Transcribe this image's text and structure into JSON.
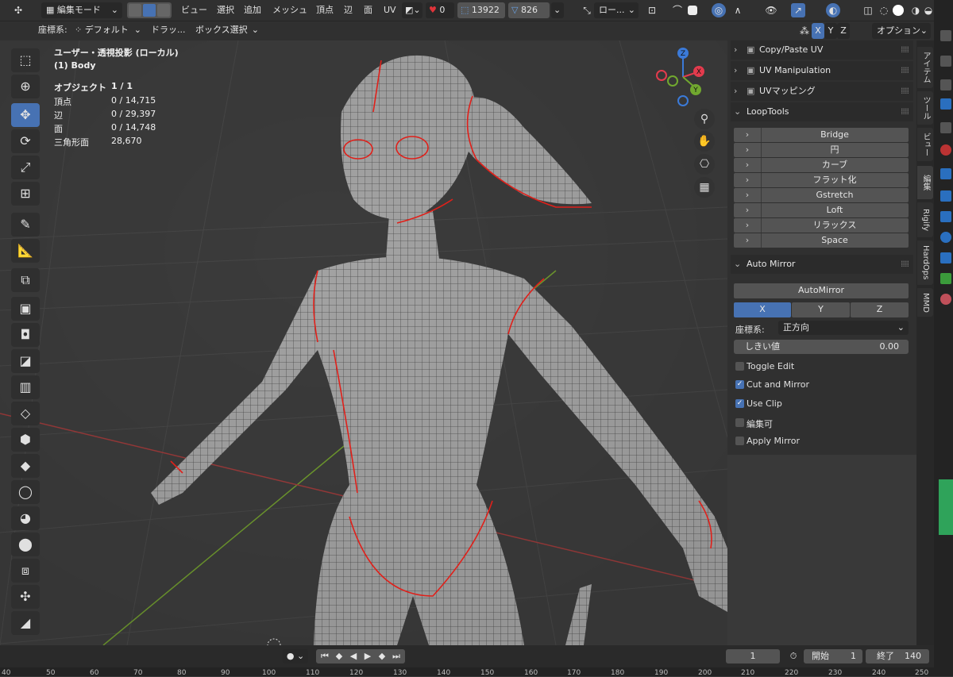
{
  "header": {
    "mode": "編集モード",
    "menus": [
      "ビュー",
      "選択",
      "追加",
      "メッシュ",
      "頂点",
      "辺",
      "面",
      "UV"
    ],
    "stats": {
      "warnings": "0",
      "vertices": "13922",
      "faces": "826"
    },
    "pivot": "ロー...",
    "coord_label": "座標系:",
    "coord_value": "デフォルト",
    "drag_label": "ドラッ...",
    "drag_value": "ボックス選択",
    "axis_x": "X",
    "axis_y": "Y",
    "axis_z": "Z",
    "options": "オプション"
  },
  "viewport": {
    "view_title": "ユーザー・透視投影 (ローカル)",
    "object_name": "(1) Body",
    "stats": [
      {
        "label": "オブジェクト",
        "value": "1 / 1"
      },
      {
        "label": "頂点",
        "value": "0 / 14,715"
      },
      {
        "label": "辺",
        "value": "0 / 29,397"
      },
      {
        "label": "面",
        "value": "0 / 14,748"
      },
      {
        "label": "三角形面",
        "value": "28,670"
      }
    ],
    "gizmo": {
      "x": "X",
      "y": "Y",
      "z": "Z"
    }
  },
  "panel": {
    "sections": [
      "Copy/Paste UV",
      "UV Manipulation",
      "UVマッピング",
      "LoopTools",
      "Auto Mirror"
    ],
    "looptools": [
      "Bridge",
      "円",
      "カーブ",
      "フラット化",
      "Gstretch",
      "Loft",
      "リラックス",
      "Space"
    ],
    "automirror": {
      "button": "AutoMirror",
      "axes": [
        "X",
        "Y",
        "Z"
      ],
      "orientation_label": "座標系:",
      "orientation_value": "正方向",
      "threshold_label": "しきい値",
      "threshold_value": "0.00",
      "options": [
        {
          "label": "Toggle Edit",
          "checked": false
        },
        {
          "label": "Cut and Mirror",
          "checked": true
        },
        {
          "label": "Use Clip",
          "checked": true
        },
        {
          "label": "編集可",
          "checked": false
        },
        {
          "label": "Apply Mirror",
          "checked": false
        }
      ]
    }
  },
  "side_tabs": [
    "アイテム",
    "ツール",
    "ビュー",
    "編集",
    "Rigify",
    "HardOps",
    "MMD"
  ],
  "timeline": {
    "current_frame": "1",
    "start_label": "開始",
    "start_value": "1",
    "end_label": "終了",
    "end_value": "140",
    "ruler": [
      "40",
      "50",
      "60",
      "70",
      "80",
      "90",
      "100",
      "110",
      "120",
      "130",
      "140",
      "150",
      "160",
      "170",
      "180",
      "190",
      "200",
      "210",
      "220",
      "230",
      "240",
      "250"
    ]
  },
  "colors": {
    "accent": "#4772b3",
    "seam": "#e0201a",
    "mesh": "#9a9a9a"
  }
}
